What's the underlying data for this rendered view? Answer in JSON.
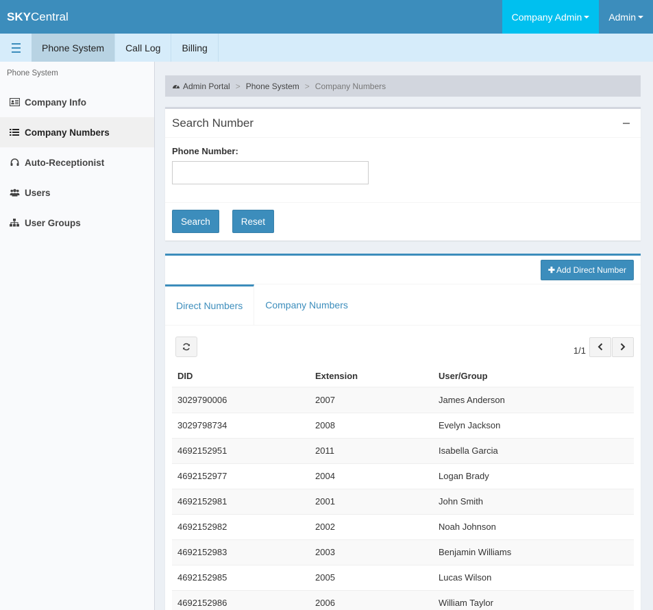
{
  "brand": {
    "bold": "SKY",
    "rest": "Central"
  },
  "topbar": {
    "company_admin": "Company Admin",
    "admin": "Admin"
  },
  "subnav": {
    "items": [
      {
        "label": "Phone System"
      },
      {
        "label": "Call Log"
      },
      {
        "label": "Billing"
      }
    ]
  },
  "sidebar": {
    "header": "Phone System",
    "items": [
      {
        "label": "Company Info",
        "icon": "id-card-icon"
      },
      {
        "label": "Company Numbers",
        "icon": "list-icon"
      },
      {
        "label": "Auto-Receptionist",
        "icon": "headset-icon"
      },
      {
        "label": "Users",
        "icon": "users-icon"
      },
      {
        "label": "User Groups",
        "icon": "sitemap-icon"
      }
    ]
  },
  "breadcrumb": {
    "home": "Admin Portal",
    "section": "Phone System",
    "current": "Company Numbers",
    "separator": ">"
  },
  "search_box": {
    "title": "Search Number",
    "phone_label": "Phone Number:",
    "phone_value": "",
    "search_label": "Search",
    "reset_label": "Reset"
  },
  "numbers_box": {
    "add_label": "Add Direct Number",
    "tabs": [
      {
        "label": "Direct Numbers"
      },
      {
        "label": "Company Numbers"
      }
    ],
    "pager": "1/1",
    "columns": {
      "did": "DID",
      "extension": "Extension",
      "user": "User/Group"
    },
    "rows": [
      {
        "did": "3029790006",
        "ext": "2007",
        "user": "James Anderson"
      },
      {
        "did": "3029798734",
        "ext": "2008",
        "user": "Evelyn Jackson"
      },
      {
        "did": "4692152951",
        "ext": "2011",
        "user": "Isabella Garcia"
      },
      {
        "did": "4692152977",
        "ext": "2004",
        "user": "Logan Brady"
      },
      {
        "did": "4692152981",
        "ext": "2001",
        "user": "John Smith"
      },
      {
        "did": "4692152982",
        "ext": "2002",
        "user": "Noah Johnson"
      },
      {
        "did": "4692152983",
        "ext": "2003",
        "user": "Benjamin Williams"
      },
      {
        "did": "4692152985",
        "ext": "2005",
        "user": "Lucas Wilson"
      },
      {
        "did": "4692152986",
        "ext": "2006",
        "user": "William Taylor"
      }
    ]
  },
  "colors": {
    "primary": "#3c8dbc",
    "active_top": "#00c0ef",
    "subnav_bg": "#d6ecfa"
  }
}
